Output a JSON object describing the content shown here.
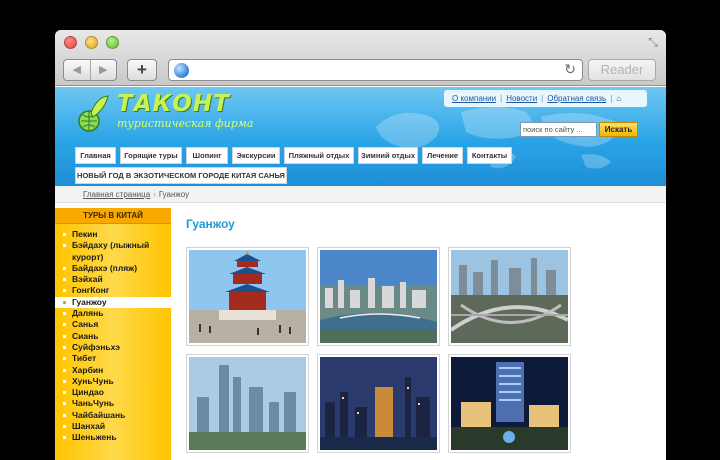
{
  "browser": {
    "reader_label": "Reader",
    "new_tab_label": "+",
    "back_glyph": "◀",
    "forward_glyph": "▶",
    "reload_glyph": "↻",
    "resize_glyph": "⤡"
  },
  "site": {
    "logo_name": "ТАКОНТ",
    "logo_subtitle": "туристическая фирма",
    "top_links": [
      "О компании",
      "Новости",
      "Обратная связь"
    ],
    "search_placeholder": "поиск по сайту ...",
    "search_button": "Искать",
    "menu": [
      "Главная",
      "Горящие туры",
      "Шопинг",
      "Экскурсии",
      "Пляжный отдых",
      "Зимний отдых",
      "Лечение",
      "Контакты",
      "НОВЫЙ ГОД В ЭКЗОТИЧЕСКОМ ГОРОДЕ КИТАЯ САНЬЯ"
    ]
  },
  "breadcrumb": {
    "home": "Главная страница",
    "separator": "›",
    "current": "Гуанжоу"
  },
  "sidebar": {
    "title": "ТУРЫ В КИТАЙ",
    "items": [
      "Пекин",
      "Бэйдаху (лыжный курорт)",
      "Байдахэ (пляж)",
      "Вэйхай",
      "ГонгКонг",
      "Гуанжоу",
      "Далянь",
      "Санья",
      "Сиань",
      "Суйфэньхэ",
      "Тибет",
      "Харбин",
      "ХуньЧунь",
      "Циндао",
      "ЧаньЧунь",
      "Чайбайшань",
      "Шанхай",
      "Шеньжень"
    ],
    "active_index": 5
  },
  "main": {
    "title": "Гуанжоу",
    "photos": [
      "temple-of-heaven-photo",
      "river-city-photo",
      "highway-interchange-photo",
      "skyscrapers-photo",
      "night-skyline-photo",
      "lit-hotel-photo"
    ]
  },
  "colors": {
    "header_blue": "#2aa4e6",
    "title_blue": "#1d9ad6",
    "sidebar_yellow": "#ffc400",
    "logo_green": "#c9f253"
  }
}
